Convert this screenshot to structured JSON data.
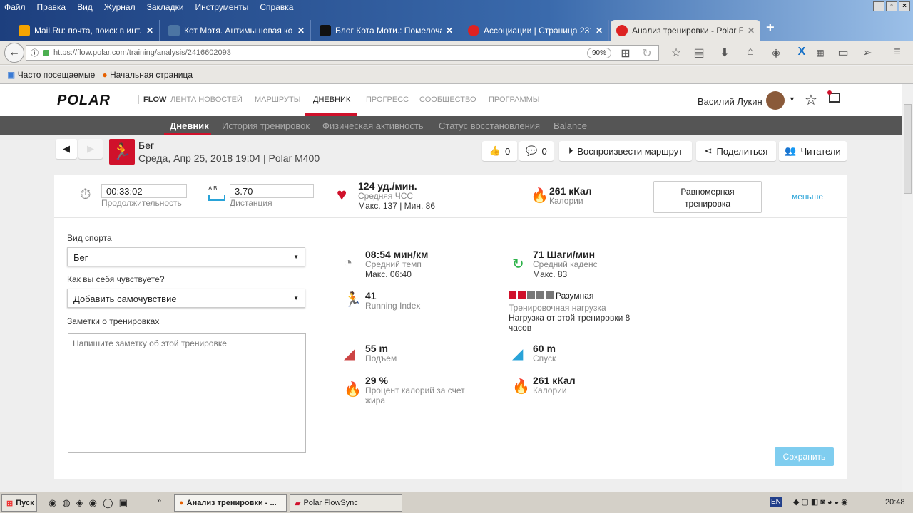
{
  "browser": {
    "menu": [
      "Файл",
      "Правка",
      "Вид",
      "Журнал",
      "Закладки",
      "Инструменты",
      "Справка"
    ],
    "tabs": [
      {
        "title": "Mail.Ru: почта, поиск в инт...",
        "color": "#f4a300"
      },
      {
        "title": "Кот Мотя. Антимышовая ко...",
        "color": "#4c75a3"
      },
      {
        "title": "Блог Кота Моти.: Помелоча...",
        "color": "#111111"
      },
      {
        "title": "Ассоциации | Страница 231...",
        "color": "#dd2222"
      },
      {
        "title": "Анализ тренировки - Polar F...",
        "color": "#dd2222"
      }
    ],
    "new_tab": "+",
    "url": "https://flow.polar.com/training/analysis/2416602093",
    "zoom": "90%",
    "bookmarks": [
      "Часто посещаемые",
      "Начальная страница"
    ]
  },
  "site": {
    "logo": "POLAR",
    "flow": "FLOW",
    "nav": [
      "ЛЕНТА НОВОСТЕЙ",
      "МАРШРУТЫ",
      "ДНЕВНИК",
      "ПРОГРЕСС",
      "СООБЩЕСТВО",
      "ПРОГРАММЫ"
    ],
    "user": "Василий Лукин",
    "subnav": [
      "Дневник",
      "История тренировок",
      "Физическая активность",
      "Статус восстановления",
      "Balance"
    ],
    "accent": "#d0112b"
  },
  "session": {
    "sport": "Бег",
    "datetime": "Среда, Апр 25, 2018 19:04 | Polar M400",
    "likes": "0",
    "comments": "0",
    "replay": "Воспроизвести маршрут",
    "share": "Поделиться",
    "readers": "Читатели"
  },
  "summary": {
    "duration": "00:33:02",
    "duration_label": "Продолжительность",
    "distance": "3.70",
    "distance_label": "Дистанция",
    "ab": "A B",
    "hr": "124 уд./мин.",
    "hr_label": "Средняя ЧСС",
    "hr_detail": "Макс. 137  |  Мин. 86",
    "kcal": "261 кКал",
    "kcal_label": "Калории",
    "type_button": "Равномерная тренировка",
    "less": "меньше"
  },
  "form": {
    "sport_label": "Вид спорта",
    "sport_value": "Бег",
    "feel_label": "Как вы себя чувствуете?",
    "feel_value": "Добавить самочувствие",
    "notes_label": "Заметки о тренировках",
    "notes_placeholder": "Напишите заметку об этой тренировке",
    "save": "Сохранить"
  },
  "stats": {
    "pace": {
      "value": "08:54 мин/км",
      "label": "Средний темп",
      "detail": "Макс. 06:40"
    },
    "cadence": {
      "value": "71 Шаги/мин",
      "label": "Средний каденс",
      "detail": "Макс. 83"
    },
    "ri": {
      "value": "41",
      "label": "Running Index"
    },
    "load": {
      "value": "Разумная",
      "label": "Тренировочная нагрузка",
      "detail": "Нагрузка от этой тренировки 8 часов",
      "level": 2,
      "max": 5
    },
    "ascent": {
      "value": "55 m",
      "label": "Подъем"
    },
    "descent": {
      "value": "60 m",
      "label": "Спуск"
    },
    "fat": {
      "value": "29 %",
      "label": "Процент калорий за счет жира"
    },
    "kcal": {
      "value": "261 кКал",
      "label": "Калории"
    }
  },
  "taskbar": {
    "start": "Пуск",
    "items": [
      "Анализ тренировки - ...",
      "Polar FlowSync"
    ],
    "lang": "EN",
    "time": "20:48"
  }
}
